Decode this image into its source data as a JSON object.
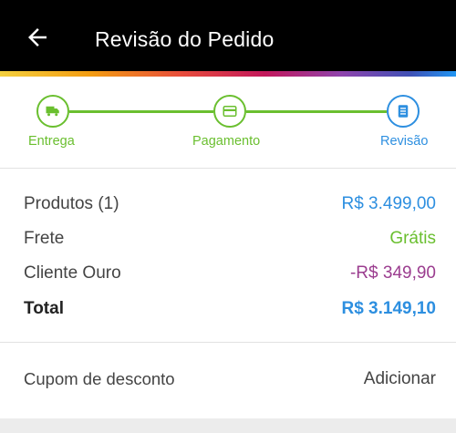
{
  "header": {
    "title": "Revisão do Pedido",
    "back_icon": "arrow-left-icon"
  },
  "stepper": {
    "steps": [
      {
        "label": "Entrega",
        "icon": "truck-icon",
        "status": "done"
      },
      {
        "label": "Pagamento",
        "icon": "credit-card-icon",
        "status": "done"
      },
      {
        "label": "Revisão",
        "icon": "document-icon",
        "status": "current"
      }
    ]
  },
  "summary": {
    "products_label": "Produtos (1)",
    "products_value": "R$ 3.499,00",
    "shipping_label": "Frete",
    "shipping_value": "Grátis",
    "discount_label": "Cliente Ouro",
    "discount_value": "-R$ 349,90",
    "total_label": "Total",
    "total_value": "R$ 3.149,10"
  },
  "coupon": {
    "label": "Cupom de desconto",
    "action": "Adicionar"
  },
  "colors": {
    "green": "#6abf2f",
    "blue": "#2d8fe0",
    "purple": "#9b3d8f",
    "header_bg": "#000000"
  }
}
